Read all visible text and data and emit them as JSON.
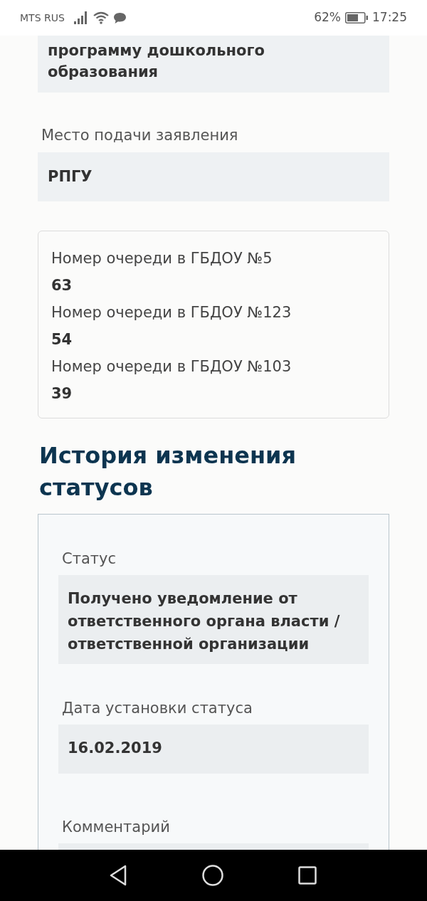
{
  "status_bar": {
    "carrier": "MTS RUS",
    "battery": "62%",
    "time": "17:25"
  },
  "top_field": {
    "value": "программу дошкольного образования"
  },
  "submission_place": {
    "label": "Место подачи заявления",
    "value": "РПГУ"
  },
  "queue_positions": [
    {
      "label": "Номер очереди в ГБДОУ №5",
      "value": "63"
    },
    {
      "label": "Номер очереди в ГБДОУ №123",
      "value": "54"
    },
    {
      "label": "Номер очереди в ГБДОУ №103",
      "value": "39"
    }
  ],
  "history": {
    "title": "История изменения статусов",
    "entries": [
      {
        "fields": [
          {
            "label": "Статус",
            "value": "Получено уведомление от ответственного органа власти / ответственной организации"
          },
          {
            "label": "Дата установки статуса",
            "value": "16.02.2019"
          },
          {
            "label": "Комментарий"
          }
        ]
      }
    ]
  }
}
